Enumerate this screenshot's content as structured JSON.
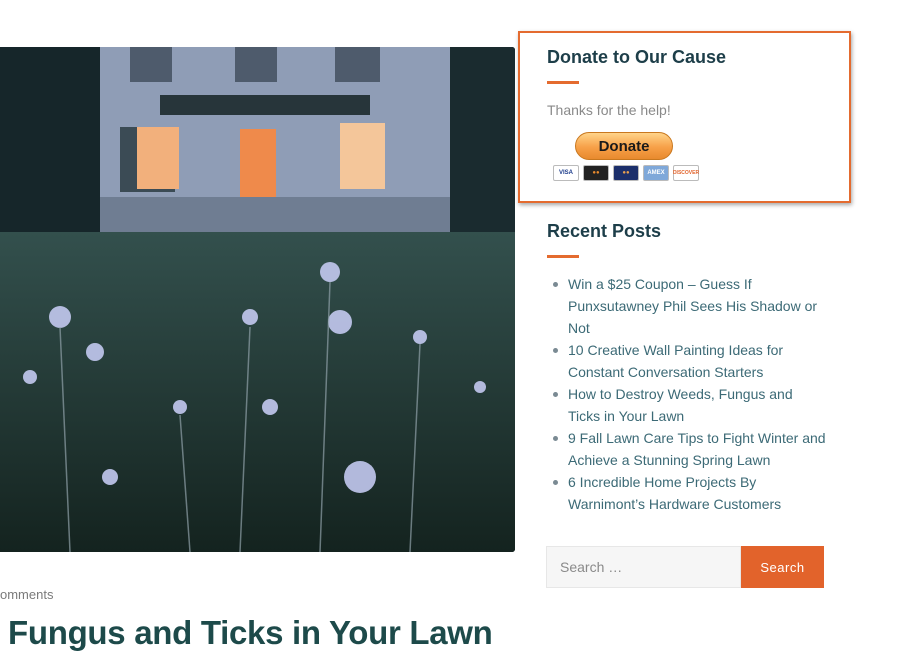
{
  "post": {
    "meta": "omments",
    "title": "Fungus and Ticks in Your Lawn"
  },
  "donate": {
    "title": "Donate to Our Cause",
    "text": "Thanks for the help!",
    "button_label": "Donate",
    "cards": [
      "VISA",
      "MC",
      "MAESTRO",
      "AMEX",
      "DISCOVER"
    ]
  },
  "recent": {
    "title": "Recent Posts",
    "items": [
      "Win a $25 Coupon – Guess If Punxsutawney Phil Sees His Shadow or Not",
      "10 Creative Wall Painting Ideas for Constant Conversation Starters",
      "How to Destroy Weeds, Fungus and Ticks in Your Lawn",
      "9 Fall Lawn Care Tips to Fight Winter and Achieve a Stunning Spring Lawn",
      "6 Incredible Home Projects By Warnimont’s Hardware Customers"
    ]
  },
  "search": {
    "placeholder": "Search …",
    "button_label": "Search"
  },
  "colors": {
    "accent": "#e2632b",
    "heading": "#1d3e49",
    "link": "#3c6a76"
  }
}
